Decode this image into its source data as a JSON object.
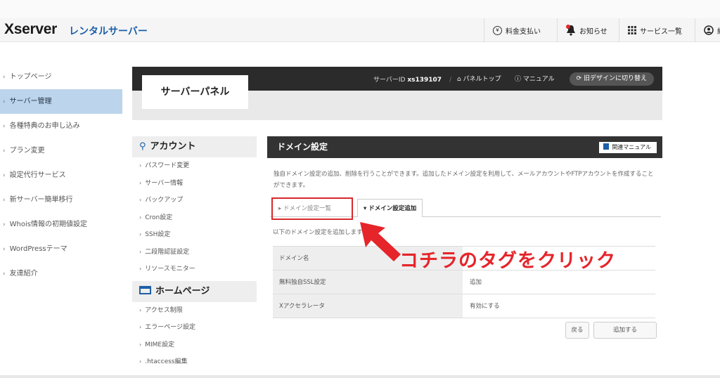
{
  "header": {
    "logo": "Xserver",
    "logo_sub": "レンタルサーバー",
    "nav": [
      {
        "label": "料金支払い",
        "icon": "yen-circle-icon"
      },
      {
        "label": "お知らせ",
        "icon": "bell-icon"
      },
      {
        "label": "サービス一覧",
        "icon": "grid-icon"
      },
      {
        "label": "級",
        "icon": "user-circle-icon"
      }
    ]
  },
  "left_nav": {
    "items": [
      {
        "label": "トップページ",
        "active": false
      },
      {
        "label": "サーバー管理",
        "active": true
      },
      {
        "label": "各種特典のお申し込み",
        "active": false
      },
      {
        "label": "プラン変更",
        "active": false
      },
      {
        "label": "設定代行サービス",
        "active": false
      },
      {
        "label": "新サーバー簡単移行",
        "active": false
      },
      {
        "label": "Whois情報の初期値設定",
        "active": false
      },
      {
        "label": "WordPressテーマ",
        "active": false
      },
      {
        "label": "友達紹介",
        "active": false
      }
    ]
  },
  "panel": {
    "title": "サーバーパネル",
    "server_id_label": "サーバーID",
    "server_id": "xs139107",
    "panel_top": "パネルトップ",
    "manual": "マニュアル",
    "old_design": "旧デザインに切り替え"
  },
  "mid_menu": {
    "account_title": "アカウント",
    "account_items": [
      "パスワード変更",
      "サーバー情報",
      "バックアップ",
      "Cron設定",
      "SSH設定",
      "二段階認証設定",
      "リソースモニター"
    ],
    "homepage_title": "ホームページ",
    "homepage_items": [
      "アクセス制限",
      "エラーページ設定",
      "MIME設定",
      ".htaccess編集"
    ]
  },
  "content": {
    "title": "ドメイン設定",
    "manual_btn": "関連マニュアル",
    "desc": "独自ドメイン設定の追加、削除を行うことができます。追加したドメイン設定を利用して、メールアカウントやFTPアカウントを作成することができます。",
    "tab_list": "ドメイン設定一覧",
    "tab_add": "ドメイン設定追加",
    "hint": "以下のドメイン設定を追加しますか？",
    "rows": [
      {
        "key": "ドメイン名",
        "value": ""
      },
      {
        "key": "無料独自SSL設定",
        "value": "追加"
      },
      {
        "key": "Xアクセラレータ",
        "value": "有効にする"
      }
    ],
    "back_btn": "戻る",
    "add_btn": "追加する"
  },
  "annotation": {
    "text": "コチラのタグをクリック",
    "color": "#e5252a"
  }
}
